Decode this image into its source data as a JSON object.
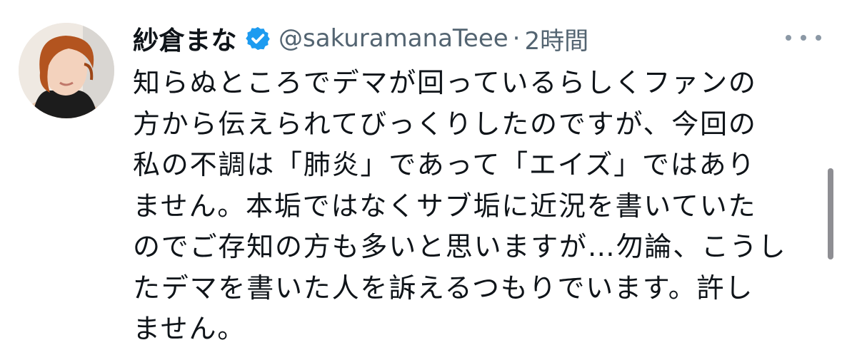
{
  "tweet": {
    "author": {
      "display_name": "紗倉まな",
      "handle": "@sakuramanaTeee",
      "verified_icon": "verified-badge-icon",
      "verified_color": "#1d9bf0"
    },
    "separator": "·",
    "timestamp": "2時間",
    "more_icon": "more-options-icon",
    "body_lines": [
      "知らぬところでデマが回っているらしくファンの",
      "方から伝えられてびっくりしたのですが、今回の",
      "私の不調は「肺炎」であって「エイズ」ではあり",
      "ません。本垢ではなくサブ垢に近況を書いていた",
      "のでご存知の方も多いと思いますが…勿論、こうし",
      "たデマを書いた人を訴えるつもりでいます。許し",
      "ません。"
    ]
  },
  "colors": {
    "text_primary": "#0f1419",
    "text_secondary": "#536471",
    "accent": "#1d9bf0",
    "background": "#ffffff"
  }
}
